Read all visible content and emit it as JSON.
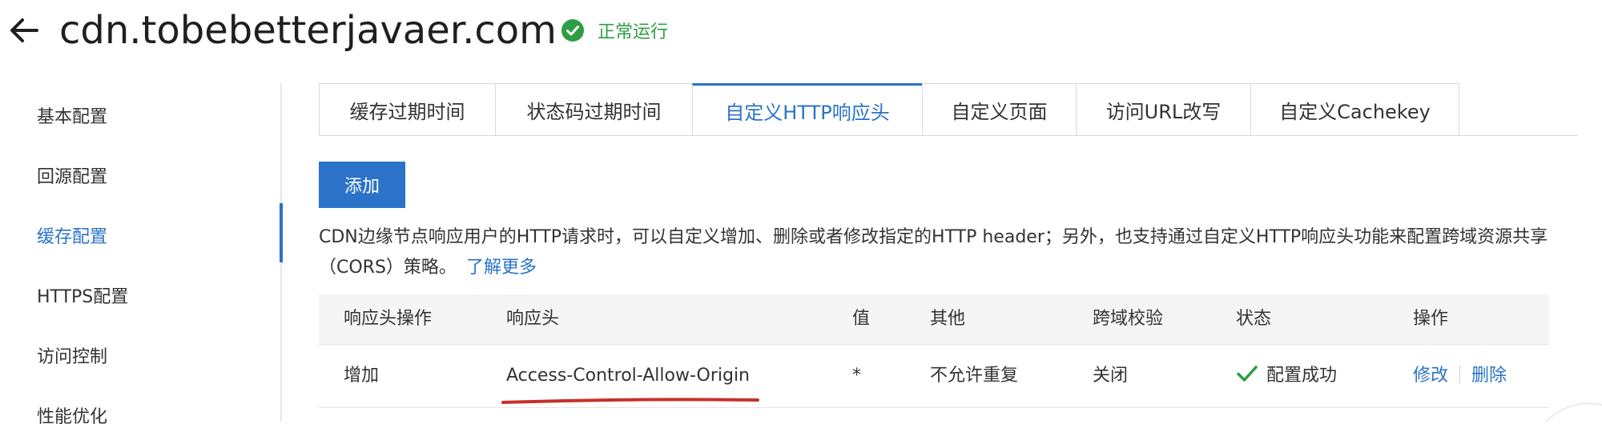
{
  "header": {
    "domain": "cdn.tobebetterjavaer.com",
    "status_text": "正常运行",
    "status_color": "#2e9e44"
  },
  "sidebar": {
    "items": [
      {
        "label": "基本配置",
        "active": false
      },
      {
        "label": "回源配置",
        "active": false
      },
      {
        "label": "缓存配置",
        "active": true
      },
      {
        "label": "HTTPS配置",
        "active": false
      },
      {
        "label": "访问控制",
        "active": false
      },
      {
        "label": "性能优化",
        "active": false
      }
    ]
  },
  "tabs": [
    {
      "label": "缓存过期时间",
      "active": false
    },
    {
      "label": "状态码过期时间",
      "active": false
    },
    {
      "label": "自定义HTTP响应头",
      "active": true
    },
    {
      "label": "自定义页面",
      "active": false
    },
    {
      "label": "访问URL改写",
      "active": false
    },
    {
      "label": "自定义Cachekey",
      "active": false
    }
  ],
  "toolbar": {
    "add_label": "添加"
  },
  "description": {
    "line1": "CDN边缘节点响应用户的HTTP请求时，可以自定义增加、删除或者修改指定的HTTP header；另外，也支持通过自定义HTTP响应头功能来配置跨域资源共享",
    "line2": "（CORS）策略。",
    "learn_more": "了解更多"
  },
  "table": {
    "columns": [
      "响应头操作",
      "响应头",
      "值",
      "其他",
      "跨域校验",
      "状态",
      "操作"
    ],
    "rows": [
      {
        "operation": "增加",
        "header": "Access-Control-Allow-Origin",
        "value": "*",
        "other": "不允许重复",
        "cors_check": "关闭",
        "status": "配置成功",
        "action_edit": "修改",
        "action_delete": "删除"
      }
    ]
  },
  "colors": {
    "accent": "#2a73c8",
    "success": "#2e9e44",
    "annotation": "#c8302a"
  }
}
